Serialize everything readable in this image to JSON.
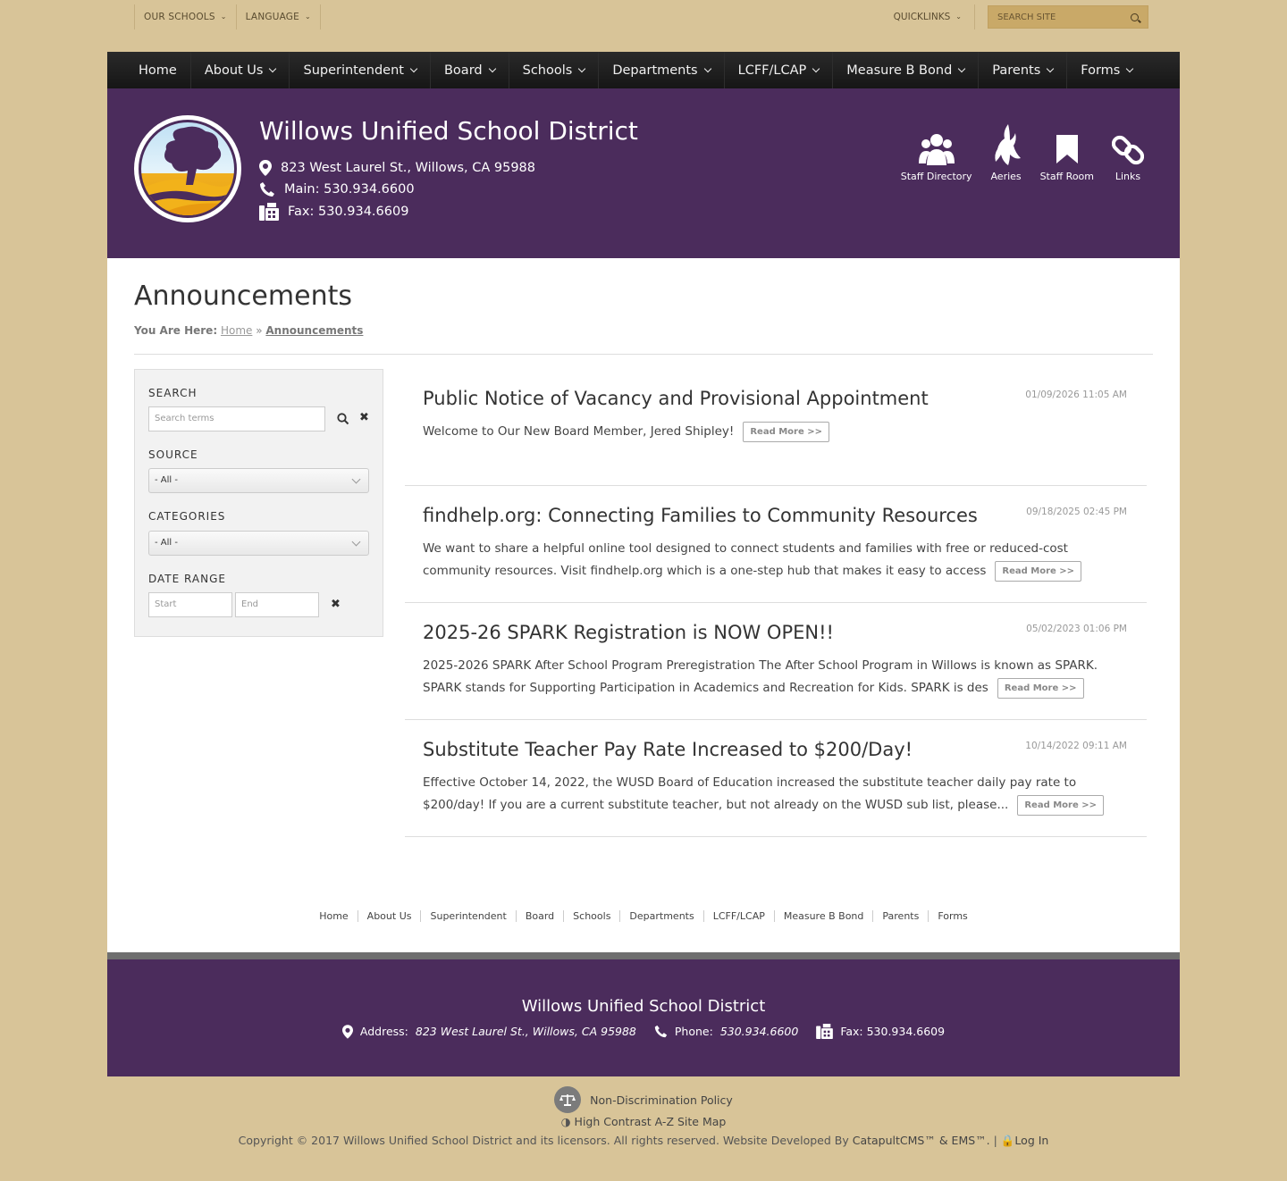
{
  "utility": {
    "left": [
      "OUR SCHOOLS",
      "LANGUAGE"
    ],
    "quicklinks": "QUICKLINKS",
    "search_placeholder": "SEARCH SITE"
  },
  "nav": {
    "items": [
      "Home",
      "About Us",
      "Superintendent",
      "Board",
      "Schools",
      "Departments",
      "LCFF/LCAP",
      "Measure B Bond",
      "Parents",
      "Forms"
    ]
  },
  "header": {
    "title": "Willows Unified School District",
    "address": "823 West Laurel St., Willows, CA 95988",
    "main": "Main: 530.934.6600",
    "fax": "Fax: 530.934.6609",
    "quick_icons": [
      "Staff Directory",
      "Aeries",
      "Staff Room",
      "Links"
    ]
  },
  "page": {
    "title": "Announcements",
    "crumb_label": "You Are Here:",
    "crumb_home": "Home",
    "crumb_current": "Announcements"
  },
  "filters": {
    "search_label": "SEARCH",
    "search_placeholder": "Search terms",
    "source_label": "SOURCE",
    "source_value": "- All -",
    "categories_label": "CATEGORIES",
    "categories_value": "- All -",
    "date_label": "DATE RANGE",
    "start_placeholder": "Start",
    "end_placeholder": "End"
  },
  "articles": [
    {
      "title": "Public Notice of Vacancy and Provisional Appointment",
      "date": "01/09/2026 11:05 AM",
      "body": "Welcome to Our New Board Member, Jered Shipley!",
      "more": "Read More >>"
    },
    {
      "title": "findhelp.org: Connecting Families to Community Resources",
      "date": "09/18/2025 02:45 PM",
      "body": "We want to share a helpful online tool designed to connect students and families with free or reduced-cost community resources. Visit findhelp.org which is a one-step hub that makes it easy to access",
      "more": "Read More >>"
    },
    {
      "title": "2025-26 SPARK Registration is NOW OPEN!!",
      "date": "05/02/2023 01:06 PM",
      "body": "2025-2026 SPARK After School Program Preregistration The After School Program in Willows is known as SPARK. SPARK stands for Supporting Participation in Academics and Recreation for Kids. SPARK is des",
      "more": "Read More >>"
    },
    {
      "title": "Substitute Teacher Pay Rate Increased to $200/Day!",
      "date": "10/14/2022 09:11 AM",
      "body": "Effective October 14, 2022, the WUSD Board of Education increased the substitute teacher daily pay rate to $200/day! If you are a current substitute teacher, but not already on the WUSD sub list, please...",
      "more": "Read More >>"
    }
  ],
  "footer_nav": [
    "Home",
    "About Us",
    "Superintendent",
    "Board",
    "Schools",
    "Departments",
    "LCFF/LCAP",
    "Measure B Bond",
    "Parents",
    "Forms"
  ],
  "footer": {
    "title": "Willows Unified School District",
    "address_label": "Address:",
    "address": "823 West Laurel St., Willows, CA 95988",
    "phone_label": "Phone:",
    "phone": "530.934.6600",
    "fax": "Fax: 530.934.6609"
  },
  "bottom": {
    "nondisc": "Non-Discrimination Policy",
    "high_contrast": "High Contrast",
    "sitemap": "A-Z Site Map",
    "copyright": "Copyright © 2017 Willows Unified School District and its licensors. All rights reserved. Website Developed By",
    "cms": "CatapultCMS™ & EMS™.",
    "login": "Log In"
  },
  "colors": {
    "page_bg": "#d8c498",
    "brand_purple": "#4b2c5c",
    "nav_dark": "#1e1e1e"
  }
}
